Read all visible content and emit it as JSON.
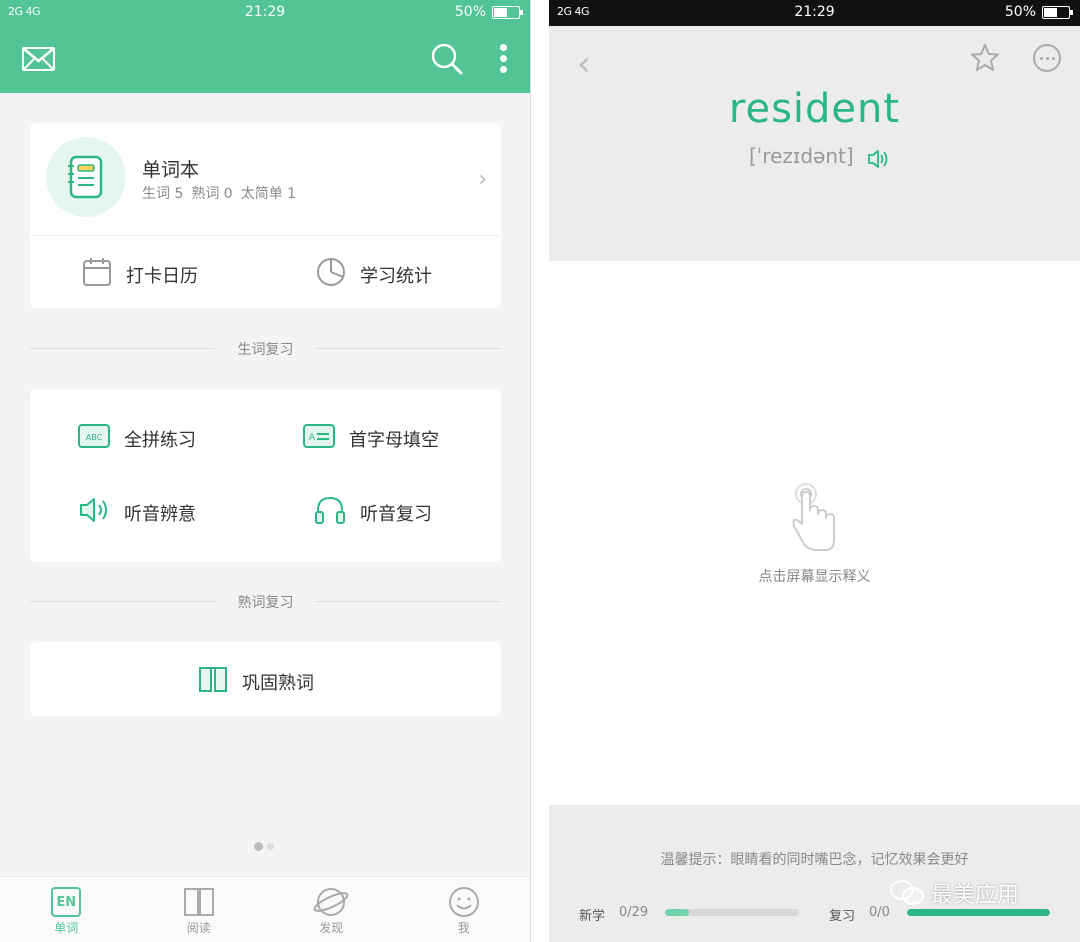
{
  "left": {
    "status": {
      "signal": "2G 4G",
      "time": "21:29",
      "battery": "50%",
      "battery_level": 0.5
    },
    "header_icons": [
      "mail-icon",
      "search-icon",
      "more-vertical-icon"
    ],
    "notebook": {
      "title": "单词本",
      "new_words": "生词 5",
      "known_words": "熟词 0",
      "too_easy": "太简单 1"
    },
    "tools": {
      "calendar": "打卡日历",
      "stats": "学习统计"
    },
    "section_new": "生词复习",
    "review_items": {
      "spell": "全拼练习",
      "initial": "首字母填空",
      "listen_meaning": "听音辨意",
      "listen_review": "听音复习"
    },
    "section_known": "熟词复习",
    "consolidate": "巩固熟词",
    "tabs": [
      {
        "label": "单词",
        "icon": "EN"
      },
      {
        "label": "阅读",
        "icon": "book-icon"
      },
      {
        "label": "发现",
        "icon": "planet-icon"
      },
      {
        "label": "我",
        "icon": "smile-icon"
      }
    ],
    "accent": "#52c496"
  },
  "right": {
    "status": {
      "signal": "2G 4G",
      "time": "21:29",
      "battery": "50%",
      "battery_level": 0.5
    },
    "word": "resident",
    "phonetic": "[ˈrezɪdənt]",
    "tap_hint": "点击屏幕显示释义",
    "tip": "温馨提示：眼睛看的同时嘴巴念，记忆效果会更好",
    "new_label": "新学",
    "new_value": "0/29",
    "new_progress": 0.18,
    "review_label": "复习",
    "review_value": "0/0",
    "review_progress": 1.0,
    "watermark": "最美应用",
    "accent": "#2bb784"
  }
}
